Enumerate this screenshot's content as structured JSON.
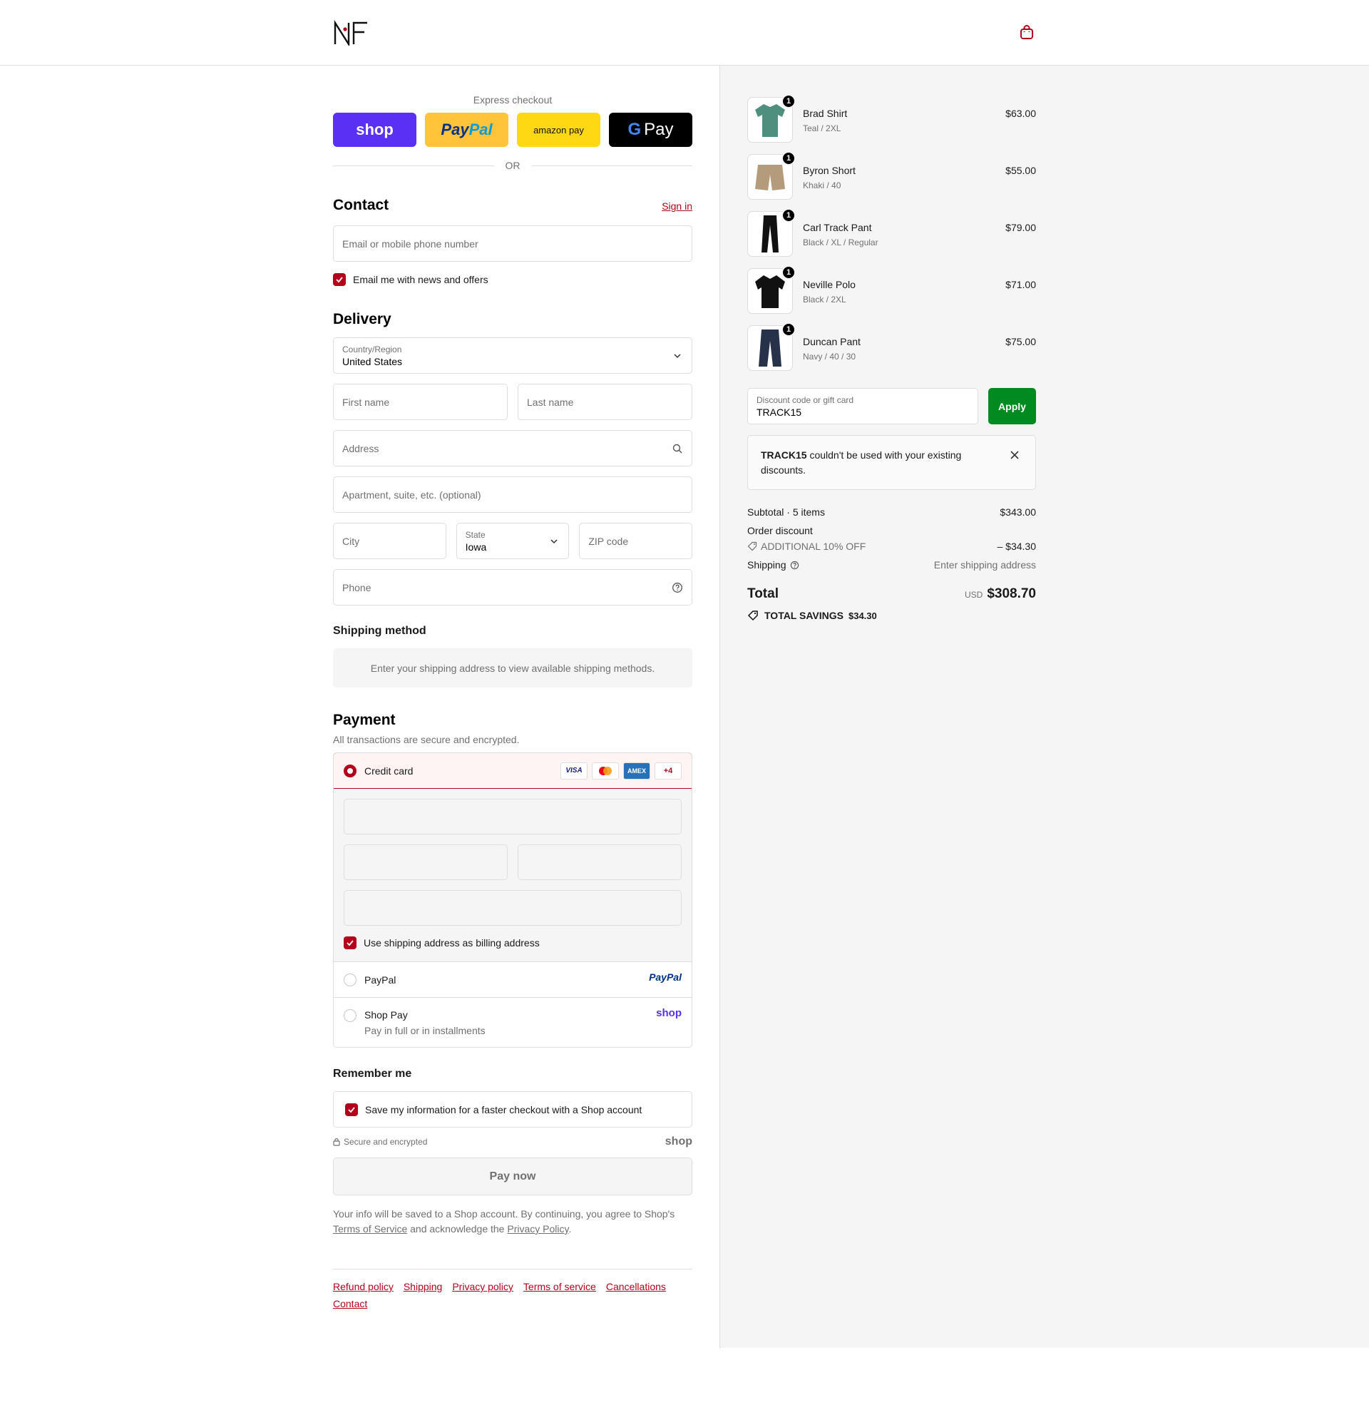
{
  "header": {
    "logo_text": "NF",
    "cart_icon": "shopping-bag-icon"
  },
  "express": {
    "title": "Express checkout",
    "shop": "shop",
    "paypal_a": "Pay",
    "paypal_b": "Pal",
    "amazon": "amazon pay",
    "gpay": "Pay",
    "or": "OR"
  },
  "contact": {
    "title": "Contact",
    "sign_in": "Sign in",
    "email_placeholder": "Email or mobile phone number",
    "news_label": "Email me with news and offers"
  },
  "delivery": {
    "title": "Delivery",
    "country_label": "Country/Region",
    "country_value": "United States",
    "first_name": "First name",
    "last_name": "Last name",
    "address": "Address",
    "apartment": "Apartment, suite, etc. (optional)",
    "city": "City",
    "state_label": "State",
    "state_value": "Iowa",
    "zip": "ZIP code",
    "phone": "Phone"
  },
  "shipping_method": {
    "title": "Shipping method",
    "message": "Enter your shipping address to view available shipping methods."
  },
  "payment": {
    "title": "Payment",
    "subtitle": "All transactions are secure and encrypted.",
    "credit_card": "Credit card",
    "visa": "VISA",
    "amex": "AMEX",
    "more": "+4",
    "billing_label": "Use shipping address as billing address",
    "paypal": "PayPal",
    "paypal_logo": "PayPal",
    "shop_pay": "Shop Pay",
    "shop_pay_sub": "Pay in full or in installments",
    "shop_logo": "shop"
  },
  "remember": {
    "title": "Remember me",
    "save_label": "Save my information for a faster checkout with a Shop account",
    "secure": "Secure and encrypted",
    "shop_logo": "shop"
  },
  "pay_now": "Pay now",
  "legal": {
    "part1": "Your info will be saved to a Shop account. By continuing, you agree to Shop's ",
    "tos": "Terms of Service",
    "part2": " and acknowledge the ",
    "privacy": "Privacy Policy",
    "part3": "."
  },
  "footer_links": [
    "Refund policy",
    "Shipping",
    "Privacy policy",
    "Terms of service",
    "Cancellations",
    "Contact"
  ],
  "cart": {
    "items": [
      {
        "name": "Brad Shirt",
        "variant": "Teal / 2XL",
        "price": "$63.00",
        "qty": "1",
        "color": "#4f8f7d"
      },
      {
        "name": "Byron Short",
        "variant": "Khaki / 40",
        "price": "$55.00",
        "qty": "1",
        "color": "#b39b7c"
      },
      {
        "name": "Carl Track Pant",
        "variant": "Black / XL / Regular",
        "price": "$79.00",
        "qty": "1",
        "color": "#111111"
      },
      {
        "name": "Neville Polo",
        "variant": "Black / 2XL",
        "price": "$71.00",
        "qty": "1",
        "color": "#111111"
      },
      {
        "name": "Duncan Pant",
        "variant": "Navy / 40 / 30",
        "price": "$75.00",
        "qty": "1",
        "color": "#27324a"
      }
    ],
    "discount_label": "Discount code or gift card",
    "discount_value": "TRACK15",
    "apply": "Apply",
    "error_code": "TRACK15",
    "error_text": " couldn't be used with your existing discounts.",
    "subtotal_label": "Subtotal · 5 items",
    "subtotal": "$343.00",
    "order_discount_label": "Order discount",
    "discount_name": "ADDITIONAL 10% OFF",
    "discount_amount": "– $34.30",
    "shipping_label": "Shipping",
    "shipping_value": "Enter shipping address",
    "total_label": "Total",
    "currency": "USD",
    "total": "$308.70",
    "savings_label": "TOTAL SAVINGS",
    "savings": "$34.30"
  }
}
